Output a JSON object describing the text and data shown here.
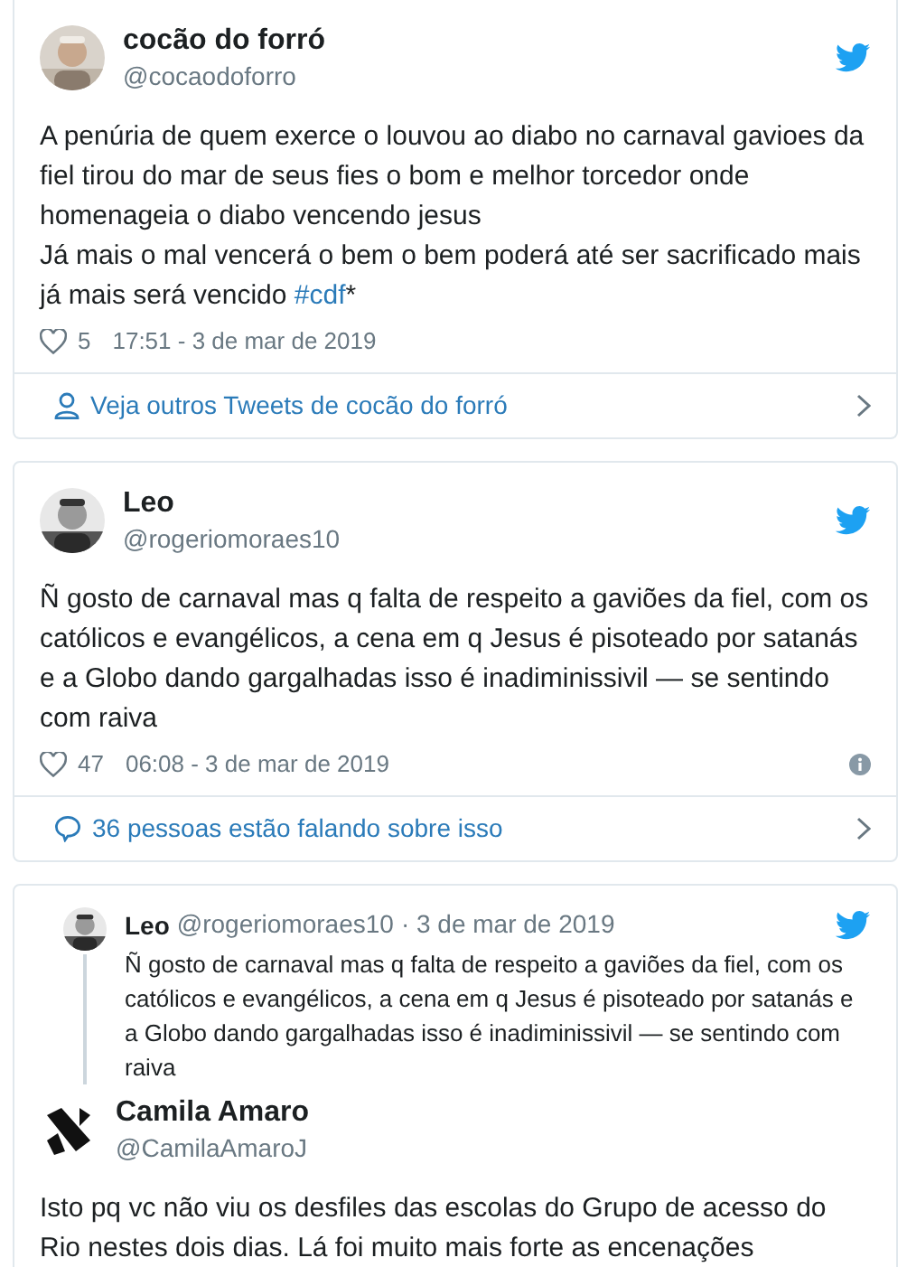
{
  "tweets": [
    {
      "kind": "tweet",
      "name": "cocão do forró",
      "handle": "@cocaodoforro",
      "paragraphs": [
        "A penúria de quem exerce o louvou ao diabo no carnaval gavioes da fiel tirou do mar de seus fies o bom e melhor torcedor onde homenageia o diabo vencendo jesus",
        "Já mais o mal vencerá o bem o  bem poderá até ser sacrificado mais já mais será vencido "
      ],
      "hashtag": "#cdf",
      "hashtag_after": "*",
      "likes": "5",
      "time": "17:51 - 3 de mar de 2019",
      "info": false,
      "footer": {
        "kind": "profile",
        "text": "Veja outros Tweets de cocão do forró"
      }
    },
    {
      "kind": "tweet",
      "name": "Leo",
      "handle": "@rogeriomoraes10",
      "paragraphs": [
        "Ñ  gosto de carnaval mas q falta de respeito a gaviões da fiel,   com os católicos e evangélicos, a cena em q  Jesus é pisoteado por satanás e a Globo dando gargalhadas isso é inadiminissivil — se sentindo com raiva"
      ],
      "likes": "47",
      "time": "06:08 - 3 de mar de 2019",
      "info": true,
      "footer": {
        "kind": "conversation",
        "text": "36 pessoas estão falando sobre isso"
      }
    },
    {
      "kind": "reply",
      "parent": {
        "name": "Leo",
        "handle": "@rogeriomoraes10",
        "date": "· 3 de mar de 2019",
        "text": "Ñ  gosto de carnaval mas q falta de respeito a gaviões da fiel,   com os católicos e evangélicos, a cena em q  Jesus é pisoteado por satanás e a Globo dando gargalhadas isso é inadiminissivil — se sentindo com raiva"
      },
      "name": "Camila Amaro",
      "handle": "@CamilaAmaroJ",
      "paragraphs": [
        "Isto pq vc não viu os desfiles das escolas do Grupo de acesso do Rio nestes dois dias. Lá foi muito mais forte as encenações"
      ]
    }
  ]
}
